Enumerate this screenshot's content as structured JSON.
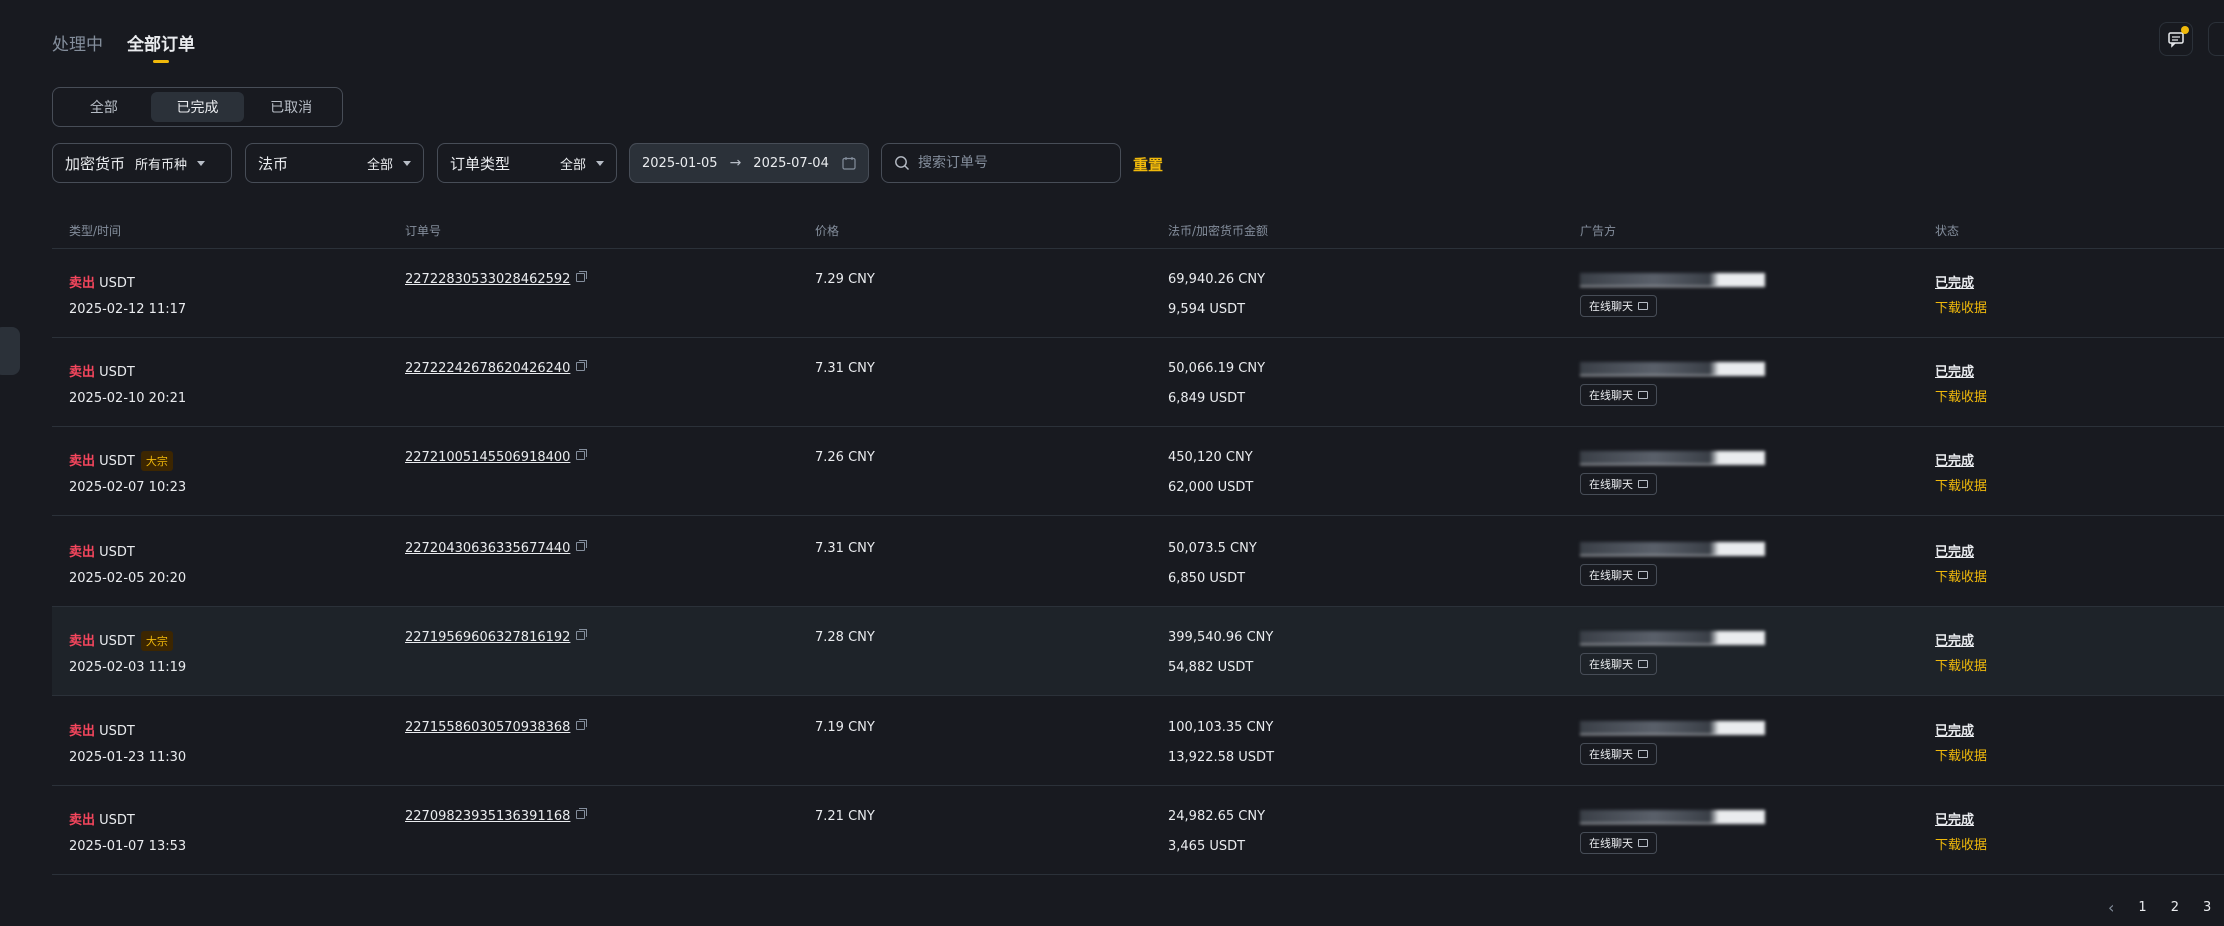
{
  "top_tabs": [
    {
      "label": "处理中",
      "active": false
    },
    {
      "label": "全部订单",
      "active": true
    }
  ],
  "segments": [
    {
      "label": "全部",
      "active": false
    },
    {
      "label": "已完成",
      "active": true
    },
    {
      "label": "已取消",
      "active": false
    }
  ],
  "filters": {
    "crypto": {
      "label": "加密货币",
      "value": "所有币种"
    },
    "fiat": {
      "label": "法币",
      "value": "全部"
    },
    "order_type": {
      "label": "订单类型",
      "value": "全部"
    },
    "date_start": "2025-01-05",
    "date_end": "2025-07-04",
    "search_placeholder": "搜索订单号",
    "reset_label": "重置"
  },
  "columns": [
    "类型/时间",
    "订单号",
    "价格",
    "法币/加密货币金额",
    "广告方",
    "状态"
  ],
  "orders": [
    {
      "side": "卖出",
      "asset": "USDT",
      "badge": "",
      "time": "2025-02-12 11:17",
      "order_no": "22722830533028462592",
      "price": "7.29 CNY",
      "fiat_amount": "69,940.26 CNY",
      "crypto_amount": "9,594 USDT",
      "chat": "在线聊天",
      "status": "已完成",
      "download": "下载收据"
    },
    {
      "side": "卖出",
      "asset": "USDT",
      "badge": "",
      "time": "2025-02-10 20:21",
      "order_no": "22722242678620426240",
      "price": "7.31 CNY",
      "fiat_amount": "50,066.19 CNY",
      "crypto_amount": "6,849 USDT",
      "chat": "在线聊天",
      "status": "已完成",
      "download": "下载收据"
    },
    {
      "side": "卖出",
      "asset": "USDT",
      "badge": "大宗",
      "time": "2025-02-07 10:23",
      "order_no": "22721005145506918400",
      "price": "7.26 CNY",
      "fiat_amount": "450,120 CNY",
      "crypto_amount": "62,000 USDT",
      "chat": "在线聊天",
      "status": "已完成",
      "download": "下载收据"
    },
    {
      "side": "卖出",
      "asset": "USDT",
      "badge": "",
      "time": "2025-02-05 20:20",
      "order_no": "22720430636335677440",
      "price": "7.31 CNY",
      "fiat_amount": "50,073.5 CNY",
      "crypto_amount": "6,850 USDT",
      "chat": "在线聊天",
      "status": "已完成",
      "download": "下载收据"
    },
    {
      "side": "卖出",
      "asset": "USDT",
      "badge": "大宗",
      "time": "2025-02-03 11:19",
      "order_no": "22719569606327816192",
      "price": "7.28 CNY",
      "fiat_amount": "399,540.96 CNY",
      "crypto_amount": "54,882 USDT",
      "chat": "在线聊天",
      "status": "已完成",
      "download": "下载收据"
    },
    {
      "side": "卖出",
      "asset": "USDT",
      "badge": "",
      "time": "2025-01-23 11:30",
      "order_no": "22715586030570938368",
      "price": "7.19 CNY",
      "fiat_amount": "100,103.35 CNY",
      "crypto_amount": "13,922.58 USDT",
      "chat": "在线聊天",
      "status": "已完成",
      "download": "下载收据"
    },
    {
      "side": "卖出",
      "asset": "USDT",
      "badge": "",
      "time": "2025-01-07 13:53",
      "order_no": "22709823935136391168",
      "price": "7.21 CNY",
      "fiat_amount": "24,982.65 CNY",
      "crypto_amount": "3,465 USDT",
      "chat": "在线聊天",
      "status": "已完成",
      "download": "下载收据"
    }
  ],
  "pagination": {
    "pages": [
      "1",
      "2",
      "3"
    ]
  },
  "colors": {
    "accent": "#f0b90b",
    "sell": "#f6465d",
    "bg": "#181a20"
  },
  "icons": [
    "chat-icon",
    "copy-icon",
    "calendar-icon",
    "search-icon",
    "chevron-left-icon"
  ]
}
